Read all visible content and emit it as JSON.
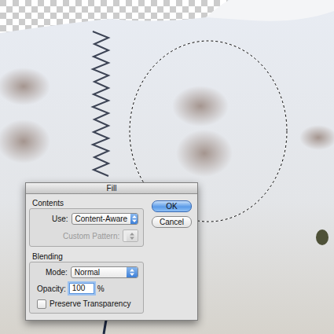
{
  "window": {
    "title": "Fill"
  },
  "canvas": {
    "selection_active": true
  },
  "contents": {
    "label": "Contents",
    "use_label": "Use:",
    "use_value": "Content-Aware",
    "custom_pattern_label": "Custom Pattern:",
    "custom_pattern_disabled": true
  },
  "blending": {
    "label": "Blending",
    "mode_label": "Mode:",
    "mode_value": "Normal",
    "opacity_label": "Opacity:",
    "opacity_value": "100",
    "opacity_focused": true,
    "opacity_unit": "%",
    "preserve_transparency": {
      "label": "Preserve Transparency",
      "checked": false
    }
  },
  "buttons": [
    {
      "label": "OK",
      "default": true
    },
    {
      "label": "Cancel",
      "default": false
    }
  ]
}
